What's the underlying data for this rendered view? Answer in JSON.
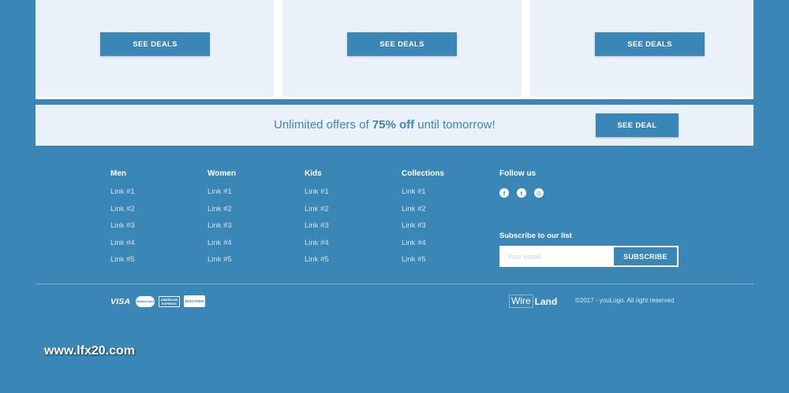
{
  "cards": {
    "see_deals_label": "SEE DEALS"
  },
  "banner": {
    "text_before": "Unlimited offers of ",
    "highlight": "75% off",
    "text_after": " until tomorrow!",
    "button_label": "SEE DEAL"
  },
  "footer": {
    "columns": [
      {
        "title": "Men",
        "links": [
          "Link #1",
          "Link #2",
          "Link #3",
          "Link #4",
          "Link #5"
        ]
      },
      {
        "title": "Women",
        "links": [
          "Link #1",
          "Link #2",
          "Link #3",
          "Link #4",
          "Link #5"
        ]
      },
      {
        "title": "Kids",
        "links": [
          "Link #1",
          "Link #2",
          "Link #3",
          "Link #4",
          "Link #5"
        ]
      },
      {
        "title": "Collections",
        "links": [
          "Link #1",
          "Link #2",
          "Link #3",
          "Link #4",
          "Link #5"
        ]
      }
    ],
    "follow": {
      "title": "Follow us",
      "icons": [
        {
          "name": "facebook-icon",
          "glyph": "f"
        },
        {
          "name": "twitter-icon",
          "glyph": "t"
        },
        {
          "name": "instagram-icon",
          "glyph": "◎"
        }
      ]
    },
    "subscribe": {
      "title": "Subscribe to our list",
      "placeholder": "Your email",
      "button_label": "SUBSCRIBE"
    },
    "payments": {
      "visa": "VISA",
      "mastercard": "MasterCard",
      "amex": "AMERICAN EXPRESS",
      "discover": "DISCOVER"
    },
    "brand": {
      "part1": "Wire",
      "part2": "Land"
    },
    "copyright": "©2017 - youLogo. All right reserved"
  },
  "watermark": "www.lfx20.com",
  "colors": {
    "primary": "#3a87b7",
    "card_bg": "#eaf1f9",
    "white": "#ffffff"
  }
}
